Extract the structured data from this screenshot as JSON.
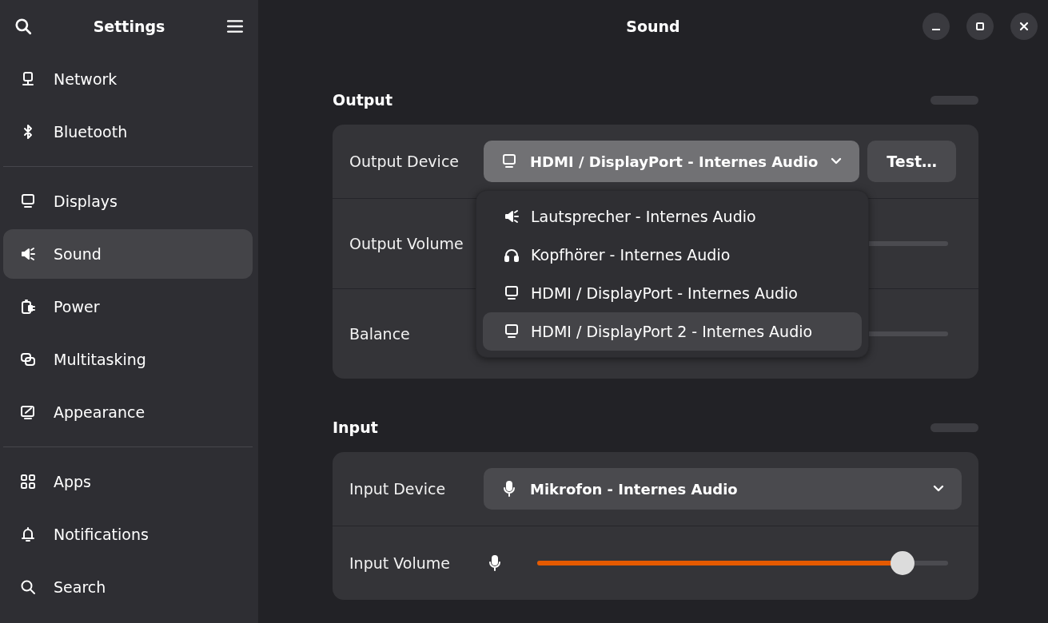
{
  "sidebar": {
    "title": "Settings",
    "groups": [
      [
        {
          "label": "Network",
          "kind": "network",
          "selected": false
        },
        {
          "label": "Bluetooth",
          "kind": "bluetooth",
          "selected": false
        }
      ],
      [
        {
          "label": "Displays",
          "kind": "display",
          "selected": false
        },
        {
          "label": "Sound",
          "kind": "sound",
          "selected": true
        },
        {
          "label": "Power",
          "kind": "power",
          "selected": false
        },
        {
          "label": "Multitasking",
          "kind": "multitask",
          "selected": false
        },
        {
          "label": "Appearance",
          "kind": "appearance",
          "selected": false
        }
      ],
      [
        {
          "label": "Apps",
          "kind": "apps",
          "selected": false
        },
        {
          "label": "Notifications",
          "kind": "bell",
          "selected": false
        },
        {
          "label": "Search",
          "kind": "search",
          "selected": false
        }
      ]
    ]
  },
  "window": {
    "title": "Sound"
  },
  "output": {
    "heading": "Output",
    "device": {
      "label": "Output Device",
      "kind": "display",
      "value": "HDMI / DisplayPort - Internes Audio",
      "expanded": true
    },
    "test_button": "Test…",
    "volume": {
      "label": "Output Volume"
    },
    "balance": {
      "label": "Balance"
    },
    "options": [
      {
        "label": "Lautsprecher - Internes Audio",
        "kind": "sound",
        "highlighted": false
      },
      {
        "label": "Kopfhörer - Internes Audio",
        "kind": "headphones",
        "highlighted": false
      },
      {
        "label": "HDMI / DisplayPort - Internes Audio",
        "kind": "display",
        "highlighted": false
      },
      {
        "label": "HDMI / DisplayPort 2 - Internes Audio",
        "kind": "display",
        "highlighted": true
      }
    ]
  },
  "input": {
    "heading": "Input",
    "device": {
      "label": "Input Device",
      "kind": "mic",
      "value": "Mikrofon - Internes Audio",
      "expanded": false
    },
    "volume": {
      "label": "Input Volume",
      "level": 0.89
    }
  }
}
